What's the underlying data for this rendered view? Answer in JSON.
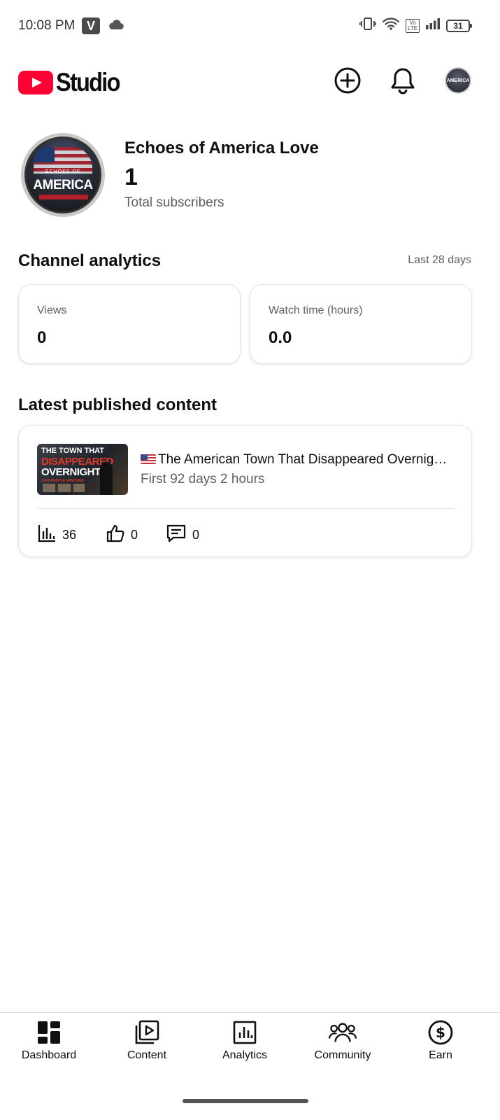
{
  "status_bar": {
    "time": "10:08 PM",
    "app_badge": "V",
    "battery": "31",
    "icons": [
      "cloud-icon",
      "vibrate-icon",
      "wifi-icon",
      "volte-icon",
      "signal-icon",
      "battery-icon"
    ]
  },
  "header": {
    "logo_text": "Studio",
    "brand_color": "#ff0033",
    "actions": [
      "create-icon",
      "notifications-icon",
      "account-avatar"
    ],
    "avatar_text": "AMERICA"
  },
  "channel": {
    "name": "Echoes of America Love",
    "subscribers": "1",
    "subscribers_label": "Total subscribers",
    "avatar_top_text": "ECHOES OF",
    "avatar_wordmark": "AMERICA"
  },
  "analytics": {
    "title": "Channel analytics",
    "period": "Last 28 days",
    "metrics": [
      {
        "label": "Views",
        "value": "0"
      },
      {
        "label": "Watch time (hours)",
        "value": "0.0"
      }
    ]
  },
  "latest": {
    "title": "Latest published content",
    "video": {
      "title": "The American Town That Disappeared Overnig…",
      "subtitle": "First 92 days 2 hours",
      "thumbnail_lines": [
        "THE TOWN THAT",
        "DISAPPEARED",
        "OVERNIGHT",
        "2,000 PEOPLE VANISHED"
      ],
      "views": "36",
      "likes": "0",
      "comments": "0"
    }
  },
  "bottom_nav": {
    "items": [
      {
        "label": "Dashboard",
        "icon": "dashboard-icon",
        "active": true
      },
      {
        "label": "Content",
        "icon": "content-icon",
        "active": false
      },
      {
        "label": "Analytics",
        "icon": "analytics-icon",
        "active": false
      },
      {
        "label": "Community",
        "icon": "community-icon",
        "active": false
      },
      {
        "label": "Earn",
        "icon": "earn-icon",
        "active": false
      }
    ]
  }
}
